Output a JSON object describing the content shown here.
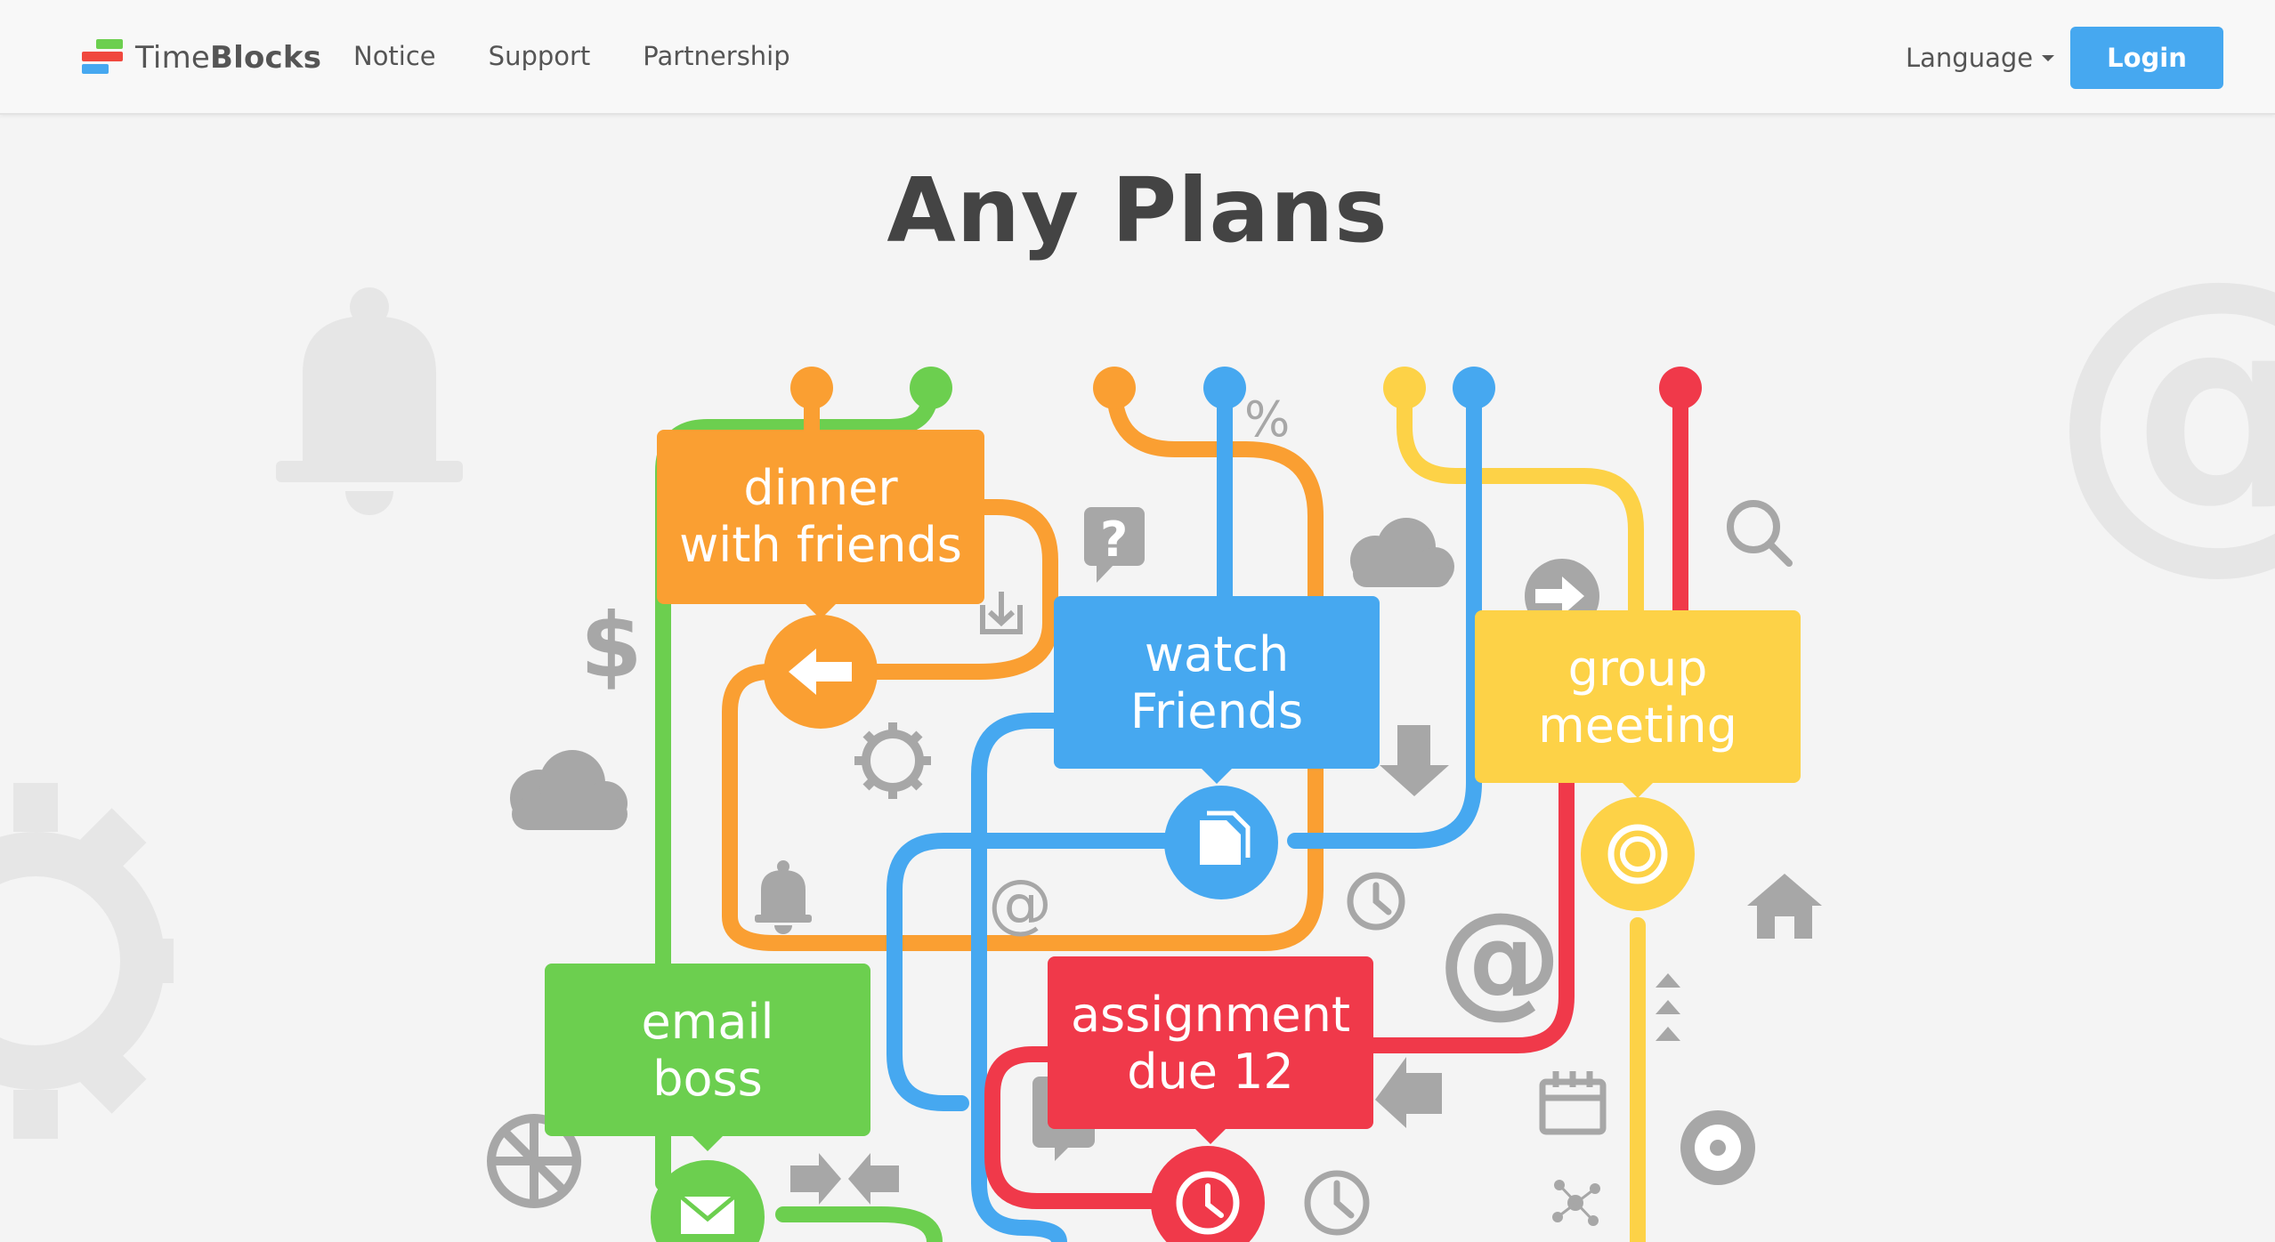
{
  "brand": {
    "name_light": "Time",
    "name_bold": "Blocks"
  },
  "nav": {
    "items": [
      "Notice",
      "Support",
      "Partnership"
    ]
  },
  "language": {
    "label": "Language"
  },
  "login": {
    "label": "Login"
  },
  "hero": {
    "title": "Any Plans"
  },
  "cards": {
    "dinner": {
      "line1": "dinner",
      "line2": "with friends",
      "color": "#fa9f32"
    },
    "watch": {
      "line1": "watch",
      "line2": "Friends",
      "color": "#46a8f0"
    },
    "group": {
      "line1": "group",
      "line2": "meeting",
      "color": "#fdd247"
    },
    "email": {
      "line1": "email",
      "line2": "boss",
      "color": "#6ccf4f"
    },
    "assignment": {
      "line1": "assignment",
      "line2": "due 12",
      "color": "#f0394a"
    }
  },
  "decor": {
    "percent": "%",
    "dollar": "$",
    "at": "@",
    "question": "?"
  },
  "colors": {
    "accent": "#46a8f0",
    "orange": "#fa9f32",
    "green": "#6ccf4f",
    "yellow": "#fdd247",
    "red": "#f0394a",
    "icon_gray": "#a7a7a7"
  }
}
